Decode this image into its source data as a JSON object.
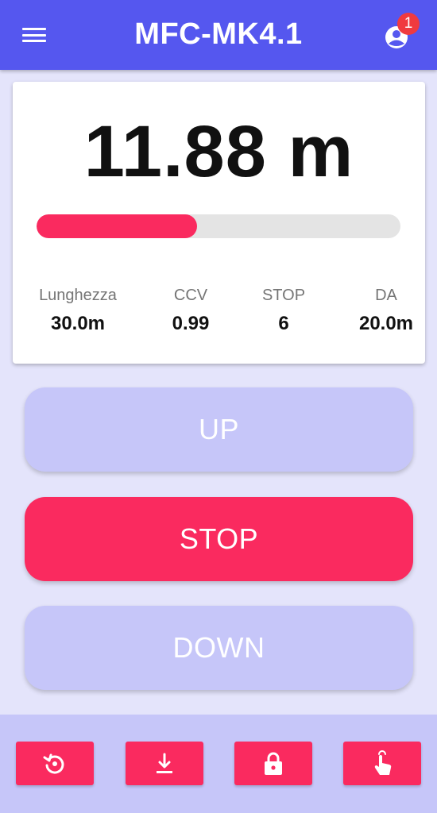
{
  "app": {
    "title": "MFC-MK4.1",
    "notification_count": "1"
  },
  "reading": {
    "value": "11.88 m",
    "progress_fraction": 0.44
  },
  "stats": [
    {
      "label": "Lunghezza",
      "value": "30.0m"
    },
    {
      "label": "CCV",
      "value": "0.99"
    },
    {
      "label": "STOP",
      "value": "6"
    },
    {
      "label": "DA",
      "value": "20.0m"
    }
  ],
  "controls": {
    "up": "UP",
    "stop": "STOP",
    "down": "DOWN"
  },
  "toolbar": {
    "icons": [
      "restore-icon",
      "download-icon",
      "lock-icon",
      "touch-icon"
    ]
  },
  "colors": {
    "appbar": "#5557ef",
    "accent": "#fa2a5f",
    "disabled_button": "#c6c6f9",
    "background": "#e4e4fb",
    "badge": "#f03a3f"
  }
}
